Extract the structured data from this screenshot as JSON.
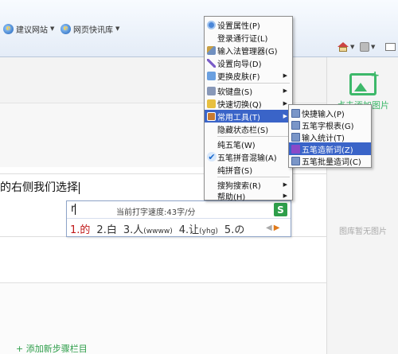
{
  "toolbar": {
    "fav_links": [
      {
        "label": "建议网站"
      },
      {
        "label": "网页快讯库"
      }
    ]
  },
  "editor": {
    "text": "的右侧我们选择"
  },
  "ime": {
    "pinyin": "r",
    "speed": "当前打字速度:43字/分",
    "logo": "S",
    "candidates": [
      {
        "num": "1.",
        "text": "的",
        "code": ""
      },
      {
        "num": "2.",
        "text": "白",
        "code": ""
      },
      {
        "num": "3.",
        "text": "人",
        "code": "(wwww)"
      },
      {
        "num": "4.",
        "text": "让",
        "code": "(yhg)"
      },
      {
        "num": "5.",
        "text": "の",
        "code": ""
      }
    ],
    "prev_arrow": "◀",
    "next_arrow": "▶"
  },
  "main_menu": {
    "items": [
      {
        "label": "设置属性(P)",
        "icon": "gear-icon",
        "arrow": ""
      },
      {
        "label": "登录通行证(L)",
        "icon": "",
        "arrow": ""
      },
      {
        "label": "输入法管理器(G)",
        "icon": "tools-icon",
        "arrow": ""
      },
      {
        "label": "设置向导(D)",
        "icon": "wand-icon",
        "arrow": ""
      },
      {
        "label": "更换皮肤(F)",
        "icon": "skin-icon",
        "arrow": "▶"
      },
      {
        "label": "软键盘(S)",
        "icon": "keyboard-icon",
        "arrow": "▶"
      },
      {
        "label": "快速切换(Q)",
        "icon": "switch-icon",
        "arrow": "▶"
      },
      {
        "label": "常用工具(T)",
        "icon": "toolbox-icon",
        "arrow": "▶"
      },
      {
        "label": "隐藏状态栏(S)",
        "icon": "",
        "arrow": ""
      },
      {
        "label": "纯五笔(W)",
        "icon": "",
        "arrow": ""
      },
      {
        "label": "五笔拼音混输(A)",
        "icon": "check-icon",
        "arrow": ""
      },
      {
        "label": "纯拼音(S)",
        "icon": "",
        "arrow": ""
      },
      {
        "label": "搜狗搜索(R)",
        "icon": "",
        "arrow": "▶"
      },
      {
        "label": "帮助(H)",
        "icon": "",
        "arrow": "▶"
      }
    ]
  },
  "tools_submenu": {
    "items": [
      {
        "label": "快捷输入(P)"
      },
      {
        "label": "五笔字根表(G)"
      },
      {
        "label": "输入统计(T)"
      },
      {
        "label": "五笔造新词(Z)"
      },
      {
        "label": "五笔批量造词(C)"
      }
    ]
  },
  "right_panel": {
    "add_image": "点击添加图片",
    "no_image": "图库暂无图片"
  },
  "bottom": {
    "add_step": "+ 添加新步骤栏目"
  },
  "colors": {
    "menu_highlight": "#3a64c8",
    "brand_green": "#3db86a"
  }
}
